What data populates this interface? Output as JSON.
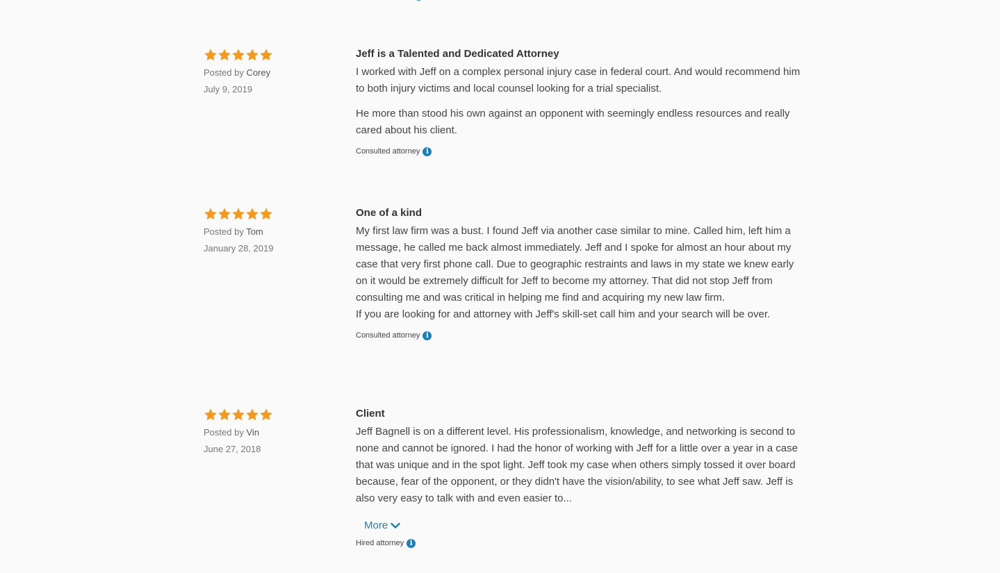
{
  "colors": {
    "star": "#f39a1c",
    "link": "#1b7fb6",
    "info": "#1b7fb6",
    "background": "#fafafa"
  },
  "reviews": [
    {
      "rating": 5,
      "posted_prefix": "Posted by ",
      "author": "Corey",
      "date": "July 9, 2019",
      "title": "Jeff is a Talented and Dedicated Attorney",
      "paragraphs": [
        "I worked with Jeff on a complex personal injury case in federal court. And would recommend him to both injury victims and local counsel looking for a trial specialist.",
        "He more than stood his own against an opponent with seemingly endless resources and really cared about his client."
      ],
      "status": "Consulted attorney",
      "info_icon": "info-icon"
    },
    {
      "rating": 5,
      "posted_prefix": "Posted by ",
      "author": "Tom",
      "date": "January 28, 2019",
      "title": "One of a kind",
      "paragraphs": [
        "My first law firm was a bust. I found Jeff via another case similar to mine. Called him, left him a message, he called me back almost immediately. Jeff and I spoke for almost an hour about my case that very first phone call. Due to geographic restraints and laws in my state we knew early on it would be extremely difficult for Jeff to become my attorney. That did not stop Jeff from consulting me and was critical in helping me find and acquiring my new law firm.",
        "If you are looking for and attorney with Jeff's skill-set call him and your search will be over."
      ],
      "status": "Consulted attorney",
      "info_icon": "info-icon"
    },
    {
      "rating": 5,
      "posted_prefix": "Posted by ",
      "author": "Vin",
      "date": "June 27, 2018",
      "title": "Client",
      "paragraphs": [
        "Jeff Bagnell is on a different level. His professionalism, knowledge, and networking is second to none and cannot be ignored. I had the honor of working with Jeff for a little over a year in a case that was unique and in the spot light. Jeff took my case when others simply tossed it over board because, fear of the opponent, or they didn't have the vision/ability, to see what Jeff saw. Jeff is also very easy to talk with and even easier to..."
      ],
      "more_label": "More",
      "status": "Hired attorney",
      "info_icon": "info-icon"
    }
  ]
}
